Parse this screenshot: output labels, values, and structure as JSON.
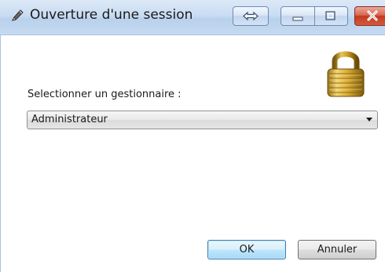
{
  "window": {
    "title": "Ouverture d'une session",
    "title_icon": "pencil-icon"
  },
  "caption_buttons": {
    "resize_icon": "double-arrow-icon",
    "minimize_icon": "minimize-icon",
    "maximize_icon": "maximize-icon",
    "close_icon": "close-icon"
  },
  "form": {
    "manager_label": "Selectionner un gestionnaire :",
    "manager_selected": "Administrateur",
    "lock_icon": "padlock-icon"
  },
  "buttons": {
    "ok_label": "OK",
    "cancel_label": "Annuler"
  },
  "colors": {
    "titlebar": "#c9dcf2",
    "close_button": "#c2391f",
    "default_button_border": "#3c7fb1"
  }
}
